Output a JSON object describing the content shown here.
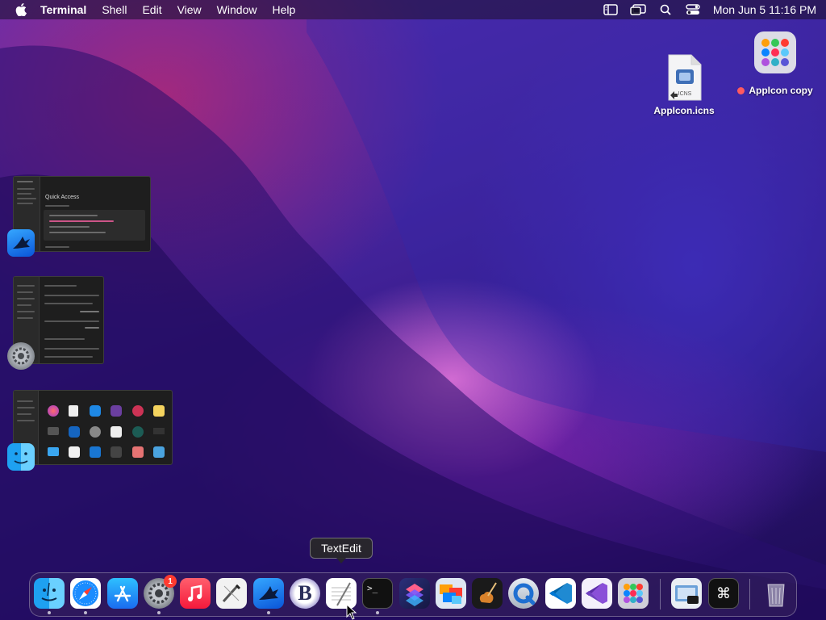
{
  "menubar": {
    "app_name": "Terminal",
    "menus": [
      "Shell",
      "Edit",
      "View",
      "Window",
      "Help"
    ],
    "clock": "Mon Jun 5  11:16 PM"
  },
  "desktop": {
    "icons": [
      {
        "label": "AppIcon.icns",
        "file_badge": "ICNS"
      },
      {
        "label": "AppIcon copy",
        "tag_color": "#ff5a5f"
      }
    ]
  },
  "thumbnails": {
    "first_title": "Quick Access"
  },
  "tooltip": {
    "text": "TextEdit"
  },
  "dock": {
    "badge_count": "1",
    "text_glyphs": {
      "bbedit": "B",
      "terminal": ">_",
      "keyboard": "⌘"
    },
    "icons": [
      "finder-icon",
      "safari-icon",
      "app-store-icon",
      "system-settings-icon",
      "music-icon",
      "script-editor-icon",
      "swift-bird-icon",
      "bbedit-icon",
      "textedit-icon",
      "terminal-icon",
      "shortcuts-icon",
      "photos-folder-icon",
      "instruments-icon",
      "quicktime-icon",
      "vscode-icon",
      "visual-studio-icon",
      "launchpad-icon",
      "preview-icon",
      "keyboard-shortcut-icon",
      "trash-icon"
    ]
  },
  "colors": {
    "accent_red": "#ff3b30",
    "menubar_text": "#ffffff"
  }
}
